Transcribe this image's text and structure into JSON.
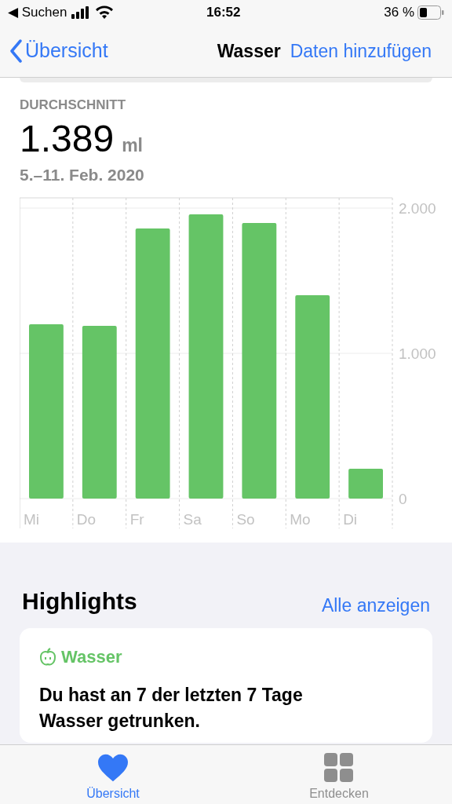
{
  "status_bar": {
    "back_app": "◀ Suchen",
    "time": "16:52",
    "battery": "36 %"
  },
  "nav_bar": {
    "back": "Übersicht",
    "title": "Wasser",
    "action": "Daten hinzufügen"
  },
  "summary": {
    "label": "DURCHSCHNITT",
    "value": "1.389",
    "unit": "ml",
    "range": "5.–11. Feb. 2020"
  },
  "chart": {
    "chart_data": {
      "type": "bar",
      "categories": [
        "Mi",
        "Do",
        "Fr",
        "Sa",
        "So",
        "Mo",
        "Di"
      ],
      "series": [
        {
          "color": "#65c466",
          "values": [
            1200,
            1189,
            1859,
            1957,
            1897,
            1400,
            205
          ]
        }
      ],
      "ylim": [
        0,
        2000
      ],
      "yticks": [
        {
          "value": 0,
          "label": "0"
        },
        {
          "value": 1000,
          "label": "1.000"
        },
        {
          "value": 2000,
          "label": "2.000"
        }
      ]
    }
  },
  "highlights": {
    "title": "Highlights",
    "link": "Alle anzeigen",
    "card": {
      "category": "Wasser",
      "text": "Du hast an 7 der letzten 7 Tage Wasser getrunken."
    }
  },
  "tab_bar": [
    {
      "label": "Übersicht",
      "selected": true,
      "kind": "heart"
    },
    {
      "label": "Entdecken",
      "selected": false,
      "kind": "grid"
    }
  ]
}
